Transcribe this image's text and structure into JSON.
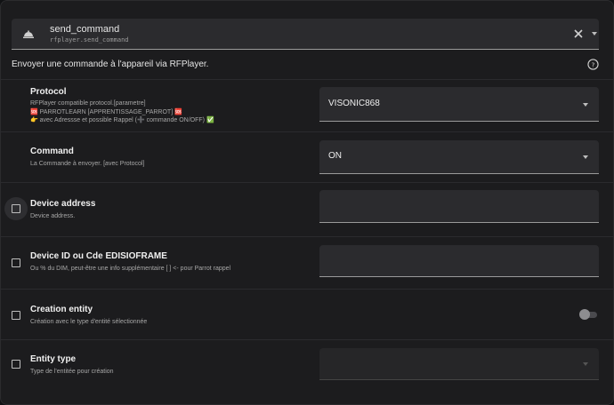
{
  "service": {
    "title": "send_command",
    "subtitle": "rfplayer.send_command",
    "description": "Envoyer une commande à l'appareil via RFPlayer."
  },
  "fields": [
    {
      "label": "Protocol",
      "help_lines": [
        "RFPlayer compatible protocol.[parametre]",
        "🆘 PARROTLEARN [APPRENTISSAGE_PARROT] 🆘",
        "👉 avec Adressse et possible Rappel (➕ commande ON/OFF) ✅"
      ],
      "value": "VISONIC868",
      "has_checkbox": false
    },
    {
      "label": "Command",
      "help_lines": [
        "La Commande à envoyer. [avec Protocol]"
      ],
      "value": "ON",
      "has_checkbox": false
    },
    {
      "label": "Device address",
      "help_lines": [
        "Device address."
      ],
      "value": "",
      "has_checkbox": true,
      "checked": false
    },
    {
      "label": "Device ID ou Cde EDISIOFRAME",
      "help_lines": [
        "Ou % du DIM, peut-être une info supplémentaire [ ] <- pour Parrot rappel"
      ],
      "value": "",
      "has_checkbox": true,
      "checked": false
    },
    {
      "label": "Creation entity",
      "help_lines": [
        "Création avec le type d'entité sélectionnée"
      ],
      "toggle_on": false,
      "has_checkbox": true,
      "checked": false
    },
    {
      "label": "Entity type",
      "help_lines": [
        "Type de l'entitée pour création"
      ],
      "value": "",
      "has_checkbox": true,
      "checked": false
    }
  ],
  "icons": {
    "service": "bell-concierge-icon",
    "clear": "close-icon",
    "expand": "chevron-down-icon",
    "help": "help-circle-icon"
  },
  "colors": {
    "background": "#1c1c1e",
    "field": "#2b2b2e",
    "text": "#e1e1e1"
  }
}
